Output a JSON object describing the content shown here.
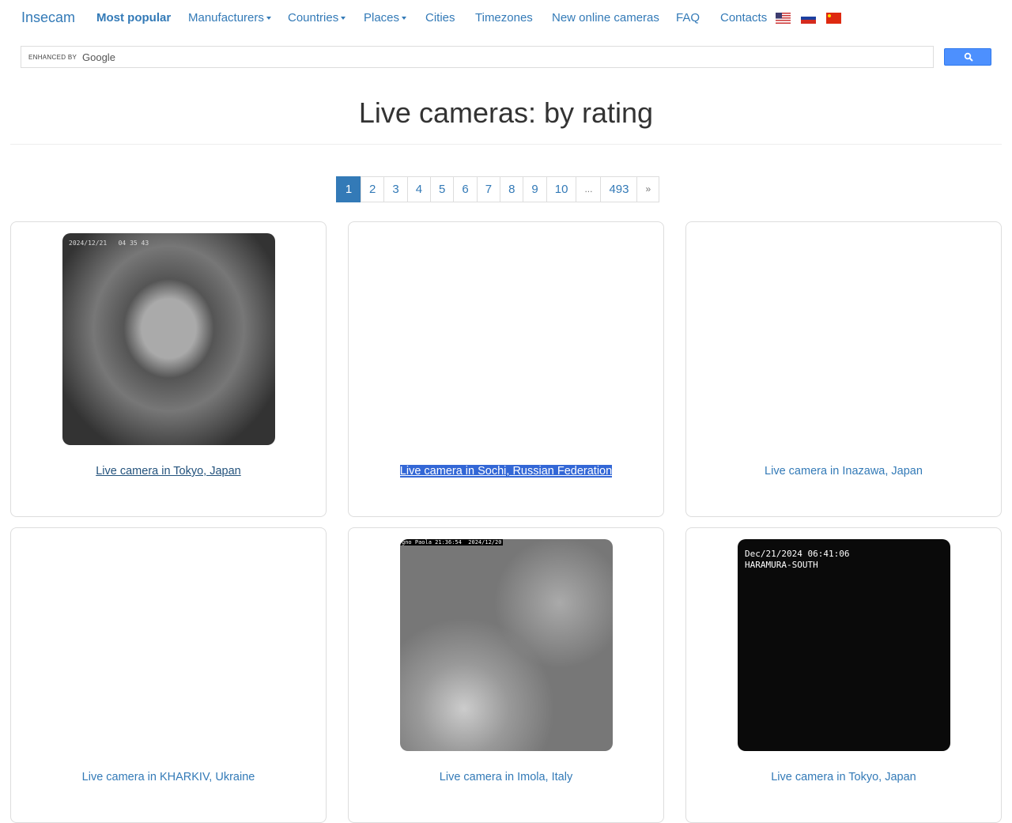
{
  "nav": {
    "brand": "Insecam",
    "most_popular": "Most popular",
    "manufacturers": "Manufacturers",
    "countries": "Countries",
    "places": "Places",
    "cities": "Cities",
    "timezones": "Timezones",
    "new_online": "New online cameras",
    "faq": "FAQ",
    "contacts": "Contacts",
    "flags": [
      "us-flag-icon",
      "ru-flag-icon",
      "cn-flag-icon"
    ]
  },
  "search": {
    "enhanced_by": "ENHANCED BY",
    "google": "Google",
    "button_icon": "search-icon",
    "accent": "#4d90fe"
  },
  "page_title": "Live cameras: by rating",
  "pagination": {
    "pages": [
      "1",
      "2",
      "3",
      "4",
      "5",
      "6",
      "7",
      "8",
      "9",
      "10",
      "...",
      "493",
      "»"
    ],
    "active": "1"
  },
  "cameras": [
    {
      "caption": "Live camera in Tokyo, Japan",
      "overlay": "2024/12/21   04 35 43"
    },
    {
      "caption": "Live camera in Sochi, Russian Federation"
    },
    {
      "caption": "Live camera in Inazawa, Japan"
    },
    {
      "caption": "Live camera in KHARKIV, Ukraine"
    },
    {
      "caption": "Live camera in Imola, Italy",
      "overlay": "gno Paola 21:36:54  2024/12/20"
    },
    {
      "caption": "Live camera in Tokyo, Japan",
      "overlay": "Dec/21/2024 06:41:06",
      "overlay2": "HARAMURA-SOUTH"
    }
  ]
}
